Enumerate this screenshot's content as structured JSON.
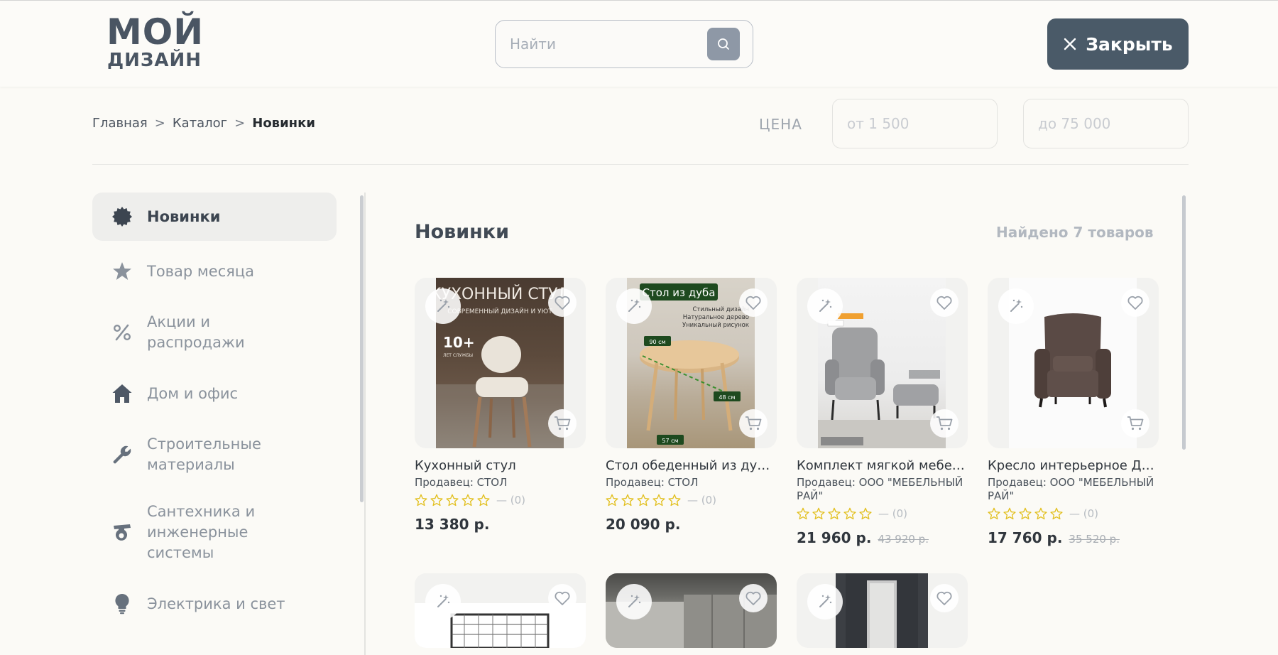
{
  "header": {
    "logo_line1": "МОЙ",
    "logo_line2": "ДИЗАЙН",
    "search_placeholder": "Найти",
    "close_label": "Закрыть"
  },
  "breadcrumb": {
    "items": [
      "Главная",
      "Каталог"
    ],
    "separator": ">",
    "current": "Новинки"
  },
  "price_filter": {
    "label": "ЦЕНА",
    "from_placeholder": "от 1 500",
    "to_placeholder": "до 75 000"
  },
  "sidebar": {
    "items": [
      {
        "label": "Новинки",
        "icon": "badge-icon",
        "active": true
      },
      {
        "label": "Товар месяца",
        "icon": "star-icon",
        "active": false
      },
      {
        "label": "Акции и распродажи",
        "icon": "percent-icon",
        "active": false
      },
      {
        "label": "Дом и офис",
        "icon": "house-icon",
        "active": false
      },
      {
        "label": "Строительные материалы",
        "icon": "wrench-icon",
        "active": false
      },
      {
        "label": "Сантехника и инженерные системы",
        "icon": "plumbing-icon",
        "active": false
      },
      {
        "label": "Электрика и свет",
        "icon": "bulb-icon",
        "active": false
      }
    ]
  },
  "content": {
    "title": "Новинки",
    "found_text": "Найдено 7 товаров"
  },
  "products": [
    {
      "title": "Кухонный стул",
      "seller": "Продавец: СТОЛ",
      "rating_text": "— (0)",
      "price": "13 380 р.",
      "old_price": "",
      "image_text": {
        "heading": "КУХОННЫЙ СТУЛ",
        "sub": "СОВРЕМЕННЫЙ ДИЗАЙН И УЮТ",
        "years": "10+",
        "years_note": "ЛЕТ СЛУЖБЫ"
      }
    },
    {
      "title": "Стол обеденный из дуб…",
      "seller": "Продавец: СТОЛ",
      "rating_text": "— (0)",
      "price": "20 090 р.",
      "old_price": "",
      "image_text": {
        "badge": "Стол из дуба",
        "f1": "Стильный дизайн",
        "f2": "Натуральное дерево",
        "f3": "Уникальный рисунок",
        "d1": "90 см",
        "d2": "48 см",
        "d3": "57 см"
      }
    },
    {
      "title": "Комплект мягкой мебел…",
      "seller": "Продавец: ООО \"МЕБЕЛЬНЫЙ РАЙ\"",
      "rating_text": "— (0)",
      "price": "21 960 р.",
      "old_price": "43 920 р."
    },
    {
      "title": "Кресло интерьерное Д…",
      "seller": "Продавец: ООО \"МЕБЕЛЬНЫЙ РАЙ\"",
      "rating_text": "— (0)",
      "price": "17 760 р.",
      "old_price": "35 520 р."
    }
  ],
  "colors": {
    "accent": "#4a5a68",
    "star": "#e2c020",
    "background": "#fbfaf6"
  }
}
